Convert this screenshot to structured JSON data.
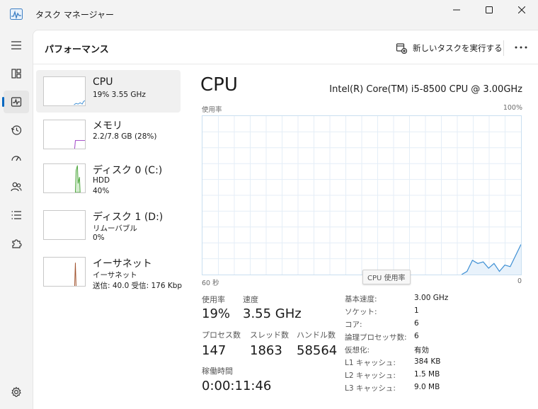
{
  "app": {
    "title": "タスク マネージャー"
  },
  "header": {
    "title": "パフォーマンス",
    "run_task_label": "新しいタスクを実行する"
  },
  "colors": {
    "accent": "#0067c0",
    "cpu": "#3d8fd4",
    "memory": "#9b3cc4",
    "disk": "#4ca63c",
    "ethernet": "#a0522d"
  },
  "resources": [
    {
      "name": "CPU",
      "line1": "19%  3.55 GHz",
      "line2": "",
      "line3": ""
    },
    {
      "name": "メモリ",
      "line1": "2.2/7.8 GB (28%)",
      "line2": "",
      "line3": ""
    },
    {
      "name": "ディスク 0 (C:)",
      "line1": "HDD",
      "line2": "40%",
      "line3": ""
    },
    {
      "name": "ディスク 1 (D:)",
      "line1": "リムーバブル",
      "line2": "0%",
      "line3": ""
    },
    {
      "name": "イーサネット",
      "line1": "イーサネット",
      "line2": "送信: 40.0  受信: 176 Kbp",
      "line3": ""
    }
  ],
  "detail": {
    "title": "CPU",
    "model": "Intel(R) Core(TM) i5-8500 CPU @ 3.00GHz",
    "usage_label": "使用率",
    "max_label": "100%",
    "time_label": "60 秒",
    "zero_label": "0",
    "tooltip": "CPU 使用率",
    "usage_history": [
      0,
      0,
      0,
      0,
      0,
      0,
      0,
      0,
      0,
      0,
      0,
      0,
      0,
      0,
      0,
      0,
      0,
      0,
      0,
      0,
      0,
      0,
      0,
      0,
      0,
      0,
      0,
      0,
      0,
      0,
      0,
      0,
      0,
      0,
      0,
      0,
      0,
      0,
      0,
      0,
      0,
      0,
      0,
      0,
      0,
      0,
      0,
      0,
      0,
      2,
      9,
      7,
      8,
      4,
      7,
      2,
      6,
      5,
      12,
      19
    ]
  },
  "stats": {
    "usage": {
      "label": "使用率",
      "value": "19%"
    },
    "speed": {
      "label": "速度",
      "value": "3.55 GHz"
    },
    "processes": {
      "label": "プロセス数",
      "value": "147"
    },
    "threads": {
      "label": "スレッド数",
      "value": "1863"
    },
    "handles": {
      "label": "ハンドル数",
      "value": "58564"
    },
    "uptime": {
      "label": "稼働時間",
      "value": "0:00:11:46"
    }
  },
  "info": [
    {
      "label": "基本速度:",
      "value": "3.00 GHz"
    },
    {
      "label": "ソケット:",
      "value": "1"
    },
    {
      "label": "コア:",
      "value": "6"
    },
    {
      "label": "論理プロセッサ数:",
      "value": "6"
    },
    {
      "label": "仮想化:",
      "value": "有効"
    },
    {
      "label": "L1 キャッシュ:",
      "value": "384 KB"
    },
    {
      "label": "L2 キャッシュ:",
      "value": "1.5 MB"
    },
    {
      "label": "L3 キャッシュ:",
      "value": "9.0 MB"
    }
  ]
}
